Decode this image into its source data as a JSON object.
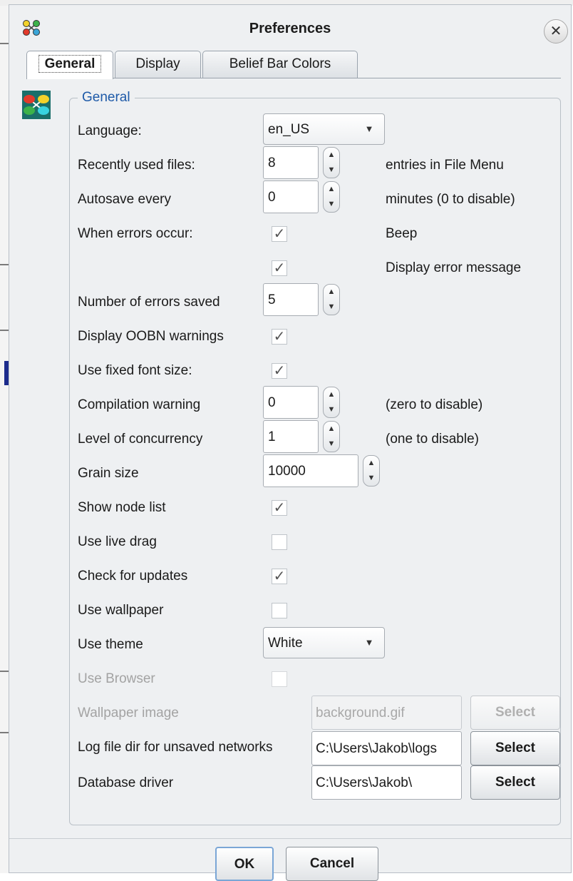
{
  "window": {
    "title": "Preferences"
  },
  "tabs": [
    {
      "label": "General",
      "active": true
    },
    {
      "label": "Display",
      "active": false
    },
    {
      "label": "Belief Bar Colors",
      "active": false
    }
  ],
  "group_title": "General",
  "rows": {
    "language": {
      "label": "Language:",
      "value": "en_US"
    },
    "recent_files": {
      "label": "Recently used files:",
      "value": "8",
      "note": "entries in File Menu"
    },
    "autosave": {
      "label": "Autosave every",
      "value": "0",
      "note": "minutes (0 to disable)"
    },
    "errors": {
      "label": "When errors occur:",
      "beep_label": "Beep",
      "beep_checked": true,
      "display_label": "Display error message",
      "display_checked": true
    },
    "num_errors": {
      "label": "Number of errors saved",
      "value": "5"
    },
    "oobn": {
      "label": "Display OOBN warnings",
      "checked": true
    },
    "fixed_font": {
      "label": "Use fixed font size:",
      "checked": true
    },
    "compilation": {
      "label": "Compilation warning",
      "value": "0",
      "note": "(zero to disable)"
    },
    "concurrency": {
      "label": "Level of concurrency",
      "value": "1",
      "note": "(one to disable)"
    },
    "grain": {
      "label": "Grain size",
      "value": "10000"
    },
    "node_list": {
      "label": "Show node list",
      "checked": true
    },
    "live_drag": {
      "label": "Use live drag",
      "checked": false
    },
    "updates": {
      "label": "Check for updates",
      "checked": true
    },
    "wallpaper": {
      "label": "Use wallpaper",
      "checked": false
    },
    "theme": {
      "label": "Use theme",
      "value": "White"
    },
    "browser": {
      "label": "Use Browser",
      "checked": false
    },
    "wallpaper_image": {
      "label": "Wallpaper image",
      "value": "background.gif",
      "button": "Select"
    },
    "log_dir": {
      "label": "Log file dir for unsaved networks",
      "value": "C:\\Users\\Jakob\\logs",
      "button": "Select"
    },
    "db_driver": {
      "label": "Database driver",
      "value": "C:\\Users\\Jakob\\",
      "button": "Select"
    }
  },
  "footer": {
    "ok": "OK",
    "cancel": "Cancel"
  },
  "colors": {
    "group_title": "#1e5aa8",
    "disabled": "#a3a3a3",
    "dialog_bg": "#eef0f2"
  },
  "icons": {
    "app": "network-nodes-icon",
    "close": "close-icon",
    "general_section": "network-nodes-icon",
    "check": "checkmark-icon",
    "dropdown": "chevron-down-icon",
    "spin_up": "spin-up-icon",
    "spin_down": "spin-down-icon"
  }
}
